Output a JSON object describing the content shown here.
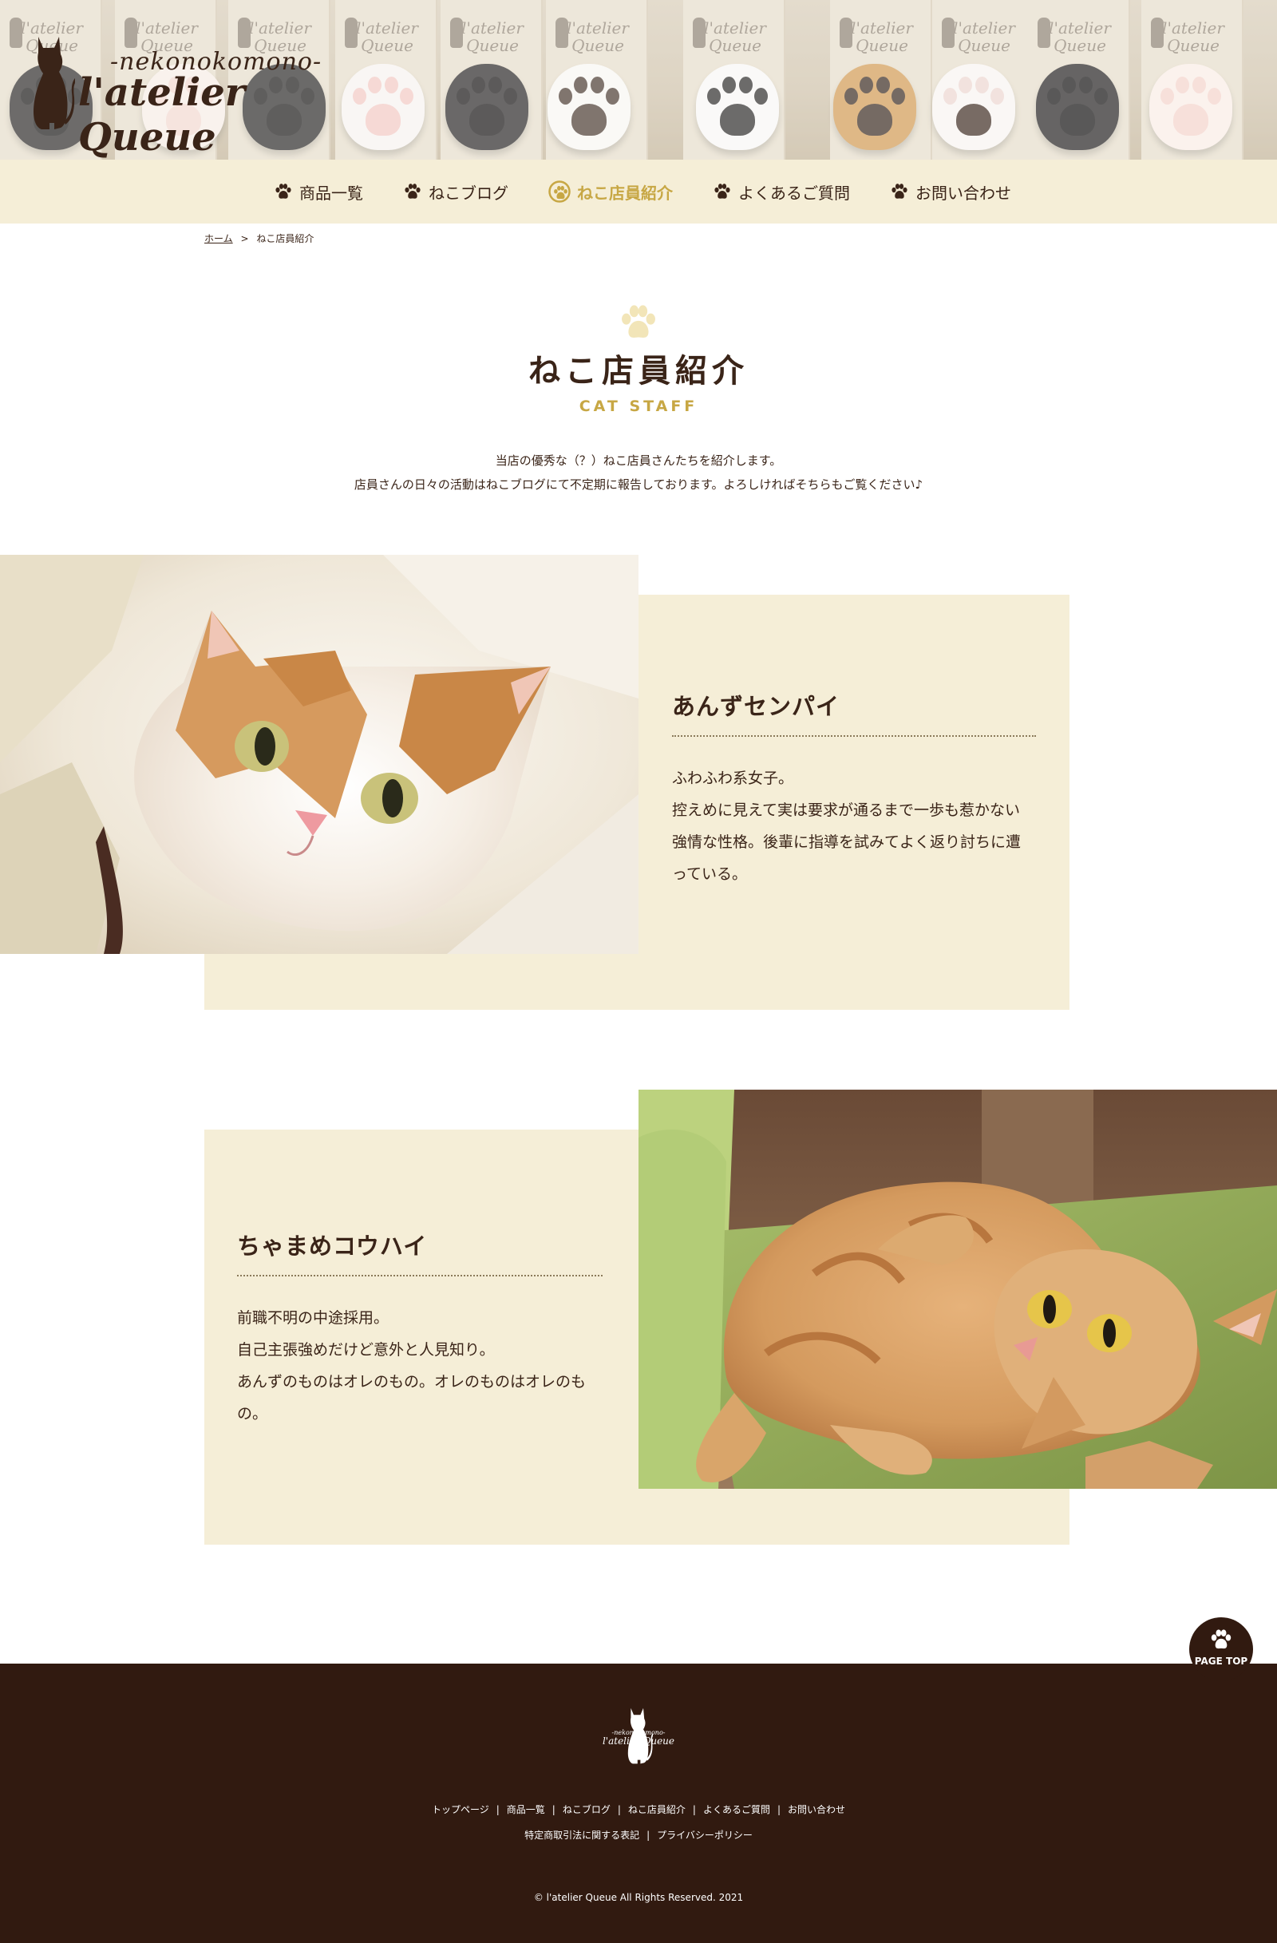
{
  "header": {
    "logo_subtitle": "-nekonokomono-",
    "logo_title": "l'atelier Queue",
    "banner_card_label": "l'atelier Queue"
  },
  "nav": {
    "items": [
      {
        "label": "商品一覧",
        "icon": "paw-icon"
      },
      {
        "label": "ねこブログ",
        "icon": "paw-icon"
      },
      {
        "label": "ねこ店員紹介",
        "icon": "paw-circle-icon",
        "active": true
      },
      {
        "label": "よくあるご質問",
        "icon": "paw-icon"
      },
      {
        "label": "お問い合わせ",
        "icon": "paw-icon"
      }
    ]
  },
  "breadcrumb": {
    "home": "ホーム",
    "separator": ">",
    "current": "ねこ店員紹介"
  },
  "page": {
    "title": "ねこ店員紹介",
    "subtitle": "CAT STAFF",
    "intro_line1": "当店の優秀な（？）ねこ店員さんたちを紹介します。",
    "intro_line2": "店員さんの日々の活動はねこブログにて不定期に報告しております。よろしければそちらもご覧ください♪"
  },
  "staff": [
    {
      "name": "あんずセンパイ",
      "lines": [
        "ふわふわ系女子。",
        "控えめに見えて実は要求が通るまで一歩も惹かない",
        "強情な性格。後輩に指導を試みてよく返り討ちに遭",
        "っている。"
      ]
    },
    {
      "name": "ちゃまめコウハイ",
      "lines": [
        "前職不明の中途採用。",
        "自己主張強めだけど意外と人見知り。",
        "あんずのものはオレのもの。オレのものはオレのも",
        "の。"
      ]
    }
  ],
  "page_top": {
    "label": "PAGE TOP"
  },
  "footer": {
    "logo_subtitle": "-nekonokomono-",
    "logo_title": "l'atelier Queue",
    "links_row1": [
      "トップページ",
      "商品一覧",
      "ねこブログ",
      "ねこ店員紹介",
      "よくあるご質問",
      "お問い合わせ"
    ],
    "links_row2": [
      "特定商取引法に関する表記",
      "プライバシーポリシー"
    ],
    "separator": "|",
    "copyright": "© l'atelier Queue All Rights Reserved. 2021"
  },
  "colors": {
    "brown": "#3a2418",
    "footer_bg": "#311a10",
    "cream": "#f5eed7",
    "gold": "#c7a744"
  }
}
